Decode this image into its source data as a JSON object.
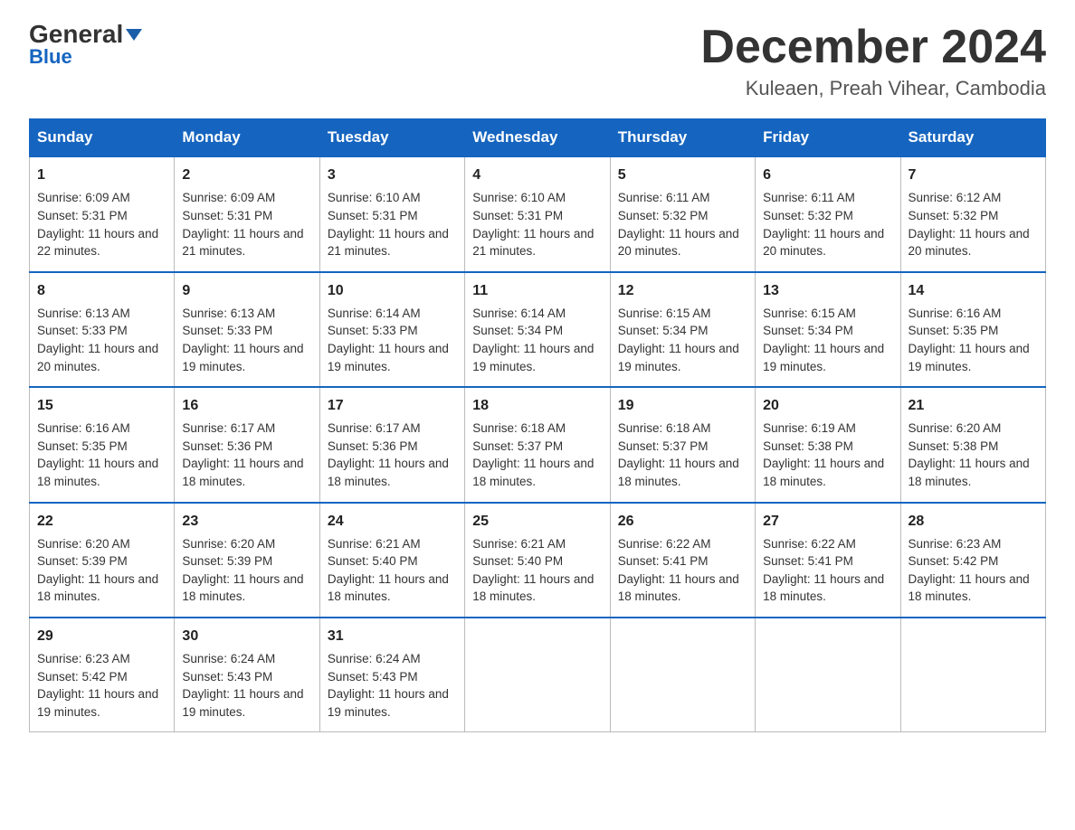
{
  "header": {
    "logo_main": "General",
    "logo_blue": "Blue",
    "month_title": "December 2024",
    "location": "Kuleaen, Preah Vihear, Cambodia"
  },
  "days_of_week": [
    "Sunday",
    "Monday",
    "Tuesday",
    "Wednesday",
    "Thursday",
    "Friday",
    "Saturday"
  ],
  "weeks": [
    [
      {
        "day": "1",
        "sunrise": "6:09 AM",
        "sunset": "5:31 PM",
        "daylight": "11 hours and 22 minutes."
      },
      {
        "day": "2",
        "sunrise": "6:09 AM",
        "sunset": "5:31 PM",
        "daylight": "11 hours and 21 minutes."
      },
      {
        "day": "3",
        "sunrise": "6:10 AM",
        "sunset": "5:31 PM",
        "daylight": "11 hours and 21 minutes."
      },
      {
        "day": "4",
        "sunrise": "6:10 AM",
        "sunset": "5:31 PM",
        "daylight": "11 hours and 21 minutes."
      },
      {
        "day": "5",
        "sunrise": "6:11 AM",
        "sunset": "5:32 PM",
        "daylight": "11 hours and 20 minutes."
      },
      {
        "day": "6",
        "sunrise": "6:11 AM",
        "sunset": "5:32 PM",
        "daylight": "11 hours and 20 minutes."
      },
      {
        "day": "7",
        "sunrise": "6:12 AM",
        "sunset": "5:32 PM",
        "daylight": "11 hours and 20 minutes."
      }
    ],
    [
      {
        "day": "8",
        "sunrise": "6:13 AM",
        "sunset": "5:33 PM",
        "daylight": "11 hours and 20 minutes."
      },
      {
        "day": "9",
        "sunrise": "6:13 AM",
        "sunset": "5:33 PM",
        "daylight": "11 hours and 19 minutes."
      },
      {
        "day": "10",
        "sunrise": "6:14 AM",
        "sunset": "5:33 PM",
        "daylight": "11 hours and 19 minutes."
      },
      {
        "day": "11",
        "sunrise": "6:14 AM",
        "sunset": "5:34 PM",
        "daylight": "11 hours and 19 minutes."
      },
      {
        "day": "12",
        "sunrise": "6:15 AM",
        "sunset": "5:34 PM",
        "daylight": "11 hours and 19 minutes."
      },
      {
        "day": "13",
        "sunrise": "6:15 AM",
        "sunset": "5:34 PM",
        "daylight": "11 hours and 19 minutes."
      },
      {
        "day": "14",
        "sunrise": "6:16 AM",
        "sunset": "5:35 PM",
        "daylight": "11 hours and 19 minutes."
      }
    ],
    [
      {
        "day": "15",
        "sunrise": "6:16 AM",
        "sunset": "5:35 PM",
        "daylight": "11 hours and 18 minutes."
      },
      {
        "day": "16",
        "sunrise": "6:17 AM",
        "sunset": "5:36 PM",
        "daylight": "11 hours and 18 minutes."
      },
      {
        "day": "17",
        "sunrise": "6:17 AM",
        "sunset": "5:36 PM",
        "daylight": "11 hours and 18 minutes."
      },
      {
        "day": "18",
        "sunrise": "6:18 AM",
        "sunset": "5:37 PM",
        "daylight": "11 hours and 18 minutes."
      },
      {
        "day": "19",
        "sunrise": "6:18 AM",
        "sunset": "5:37 PM",
        "daylight": "11 hours and 18 minutes."
      },
      {
        "day": "20",
        "sunrise": "6:19 AM",
        "sunset": "5:38 PM",
        "daylight": "11 hours and 18 minutes."
      },
      {
        "day": "21",
        "sunrise": "6:20 AM",
        "sunset": "5:38 PM",
        "daylight": "11 hours and 18 minutes."
      }
    ],
    [
      {
        "day": "22",
        "sunrise": "6:20 AM",
        "sunset": "5:39 PM",
        "daylight": "11 hours and 18 minutes."
      },
      {
        "day": "23",
        "sunrise": "6:20 AM",
        "sunset": "5:39 PM",
        "daylight": "11 hours and 18 minutes."
      },
      {
        "day": "24",
        "sunrise": "6:21 AM",
        "sunset": "5:40 PM",
        "daylight": "11 hours and 18 minutes."
      },
      {
        "day": "25",
        "sunrise": "6:21 AM",
        "sunset": "5:40 PM",
        "daylight": "11 hours and 18 minutes."
      },
      {
        "day": "26",
        "sunrise": "6:22 AM",
        "sunset": "5:41 PM",
        "daylight": "11 hours and 18 minutes."
      },
      {
        "day": "27",
        "sunrise": "6:22 AM",
        "sunset": "5:41 PM",
        "daylight": "11 hours and 18 minutes."
      },
      {
        "day": "28",
        "sunrise": "6:23 AM",
        "sunset": "5:42 PM",
        "daylight": "11 hours and 18 minutes."
      }
    ],
    [
      {
        "day": "29",
        "sunrise": "6:23 AM",
        "sunset": "5:42 PM",
        "daylight": "11 hours and 19 minutes."
      },
      {
        "day": "30",
        "sunrise": "6:24 AM",
        "sunset": "5:43 PM",
        "daylight": "11 hours and 19 minutes."
      },
      {
        "day": "31",
        "sunrise": "6:24 AM",
        "sunset": "5:43 PM",
        "daylight": "11 hours and 19 minutes."
      },
      null,
      null,
      null,
      null
    ]
  ],
  "labels": {
    "sunrise_prefix": "Sunrise: ",
    "sunset_prefix": "Sunset: ",
    "daylight_prefix": "Daylight: "
  }
}
